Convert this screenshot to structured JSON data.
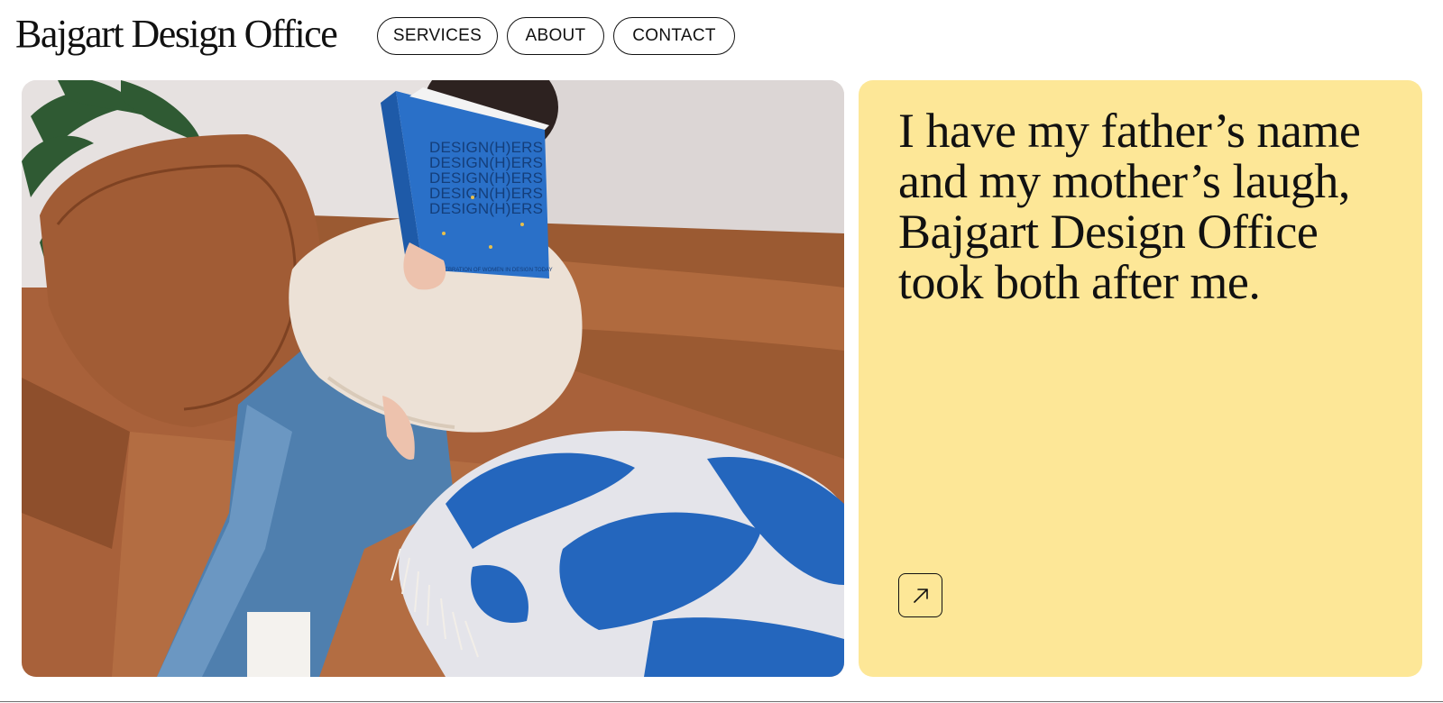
{
  "header": {
    "logo": "Bajgart Design Office",
    "nav": [
      {
        "label": "SERVICES"
      },
      {
        "label": "ABOUT"
      },
      {
        "label": "CONTACT"
      }
    ]
  },
  "hero_image": {
    "book_title_lines": [
      "DESIGN(H)ERS",
      "DESIGN(H)ERS",
      "DESIGN(H)ERS",
      "DESIGN(H)ERS",
      "DESIGN(H)ERS"
    ],
    "book_subtitle": "A CELEBRATION OF WOMEN IN DESIGN TODAY"
  },
  "quote_card": {
    "text": "I have my father’s name and my mother’s laugh, Bajgart Design Office took both after me.",
    "background": "#fde797",
    "arrow_icon": "arrow-up-right-icon"
  },
  "colors": {
    "page_bg": "#ffffff",
    "text": "#111111",
    "card_yellow": "#fde797",
    "sofa_brown": "#a55f35",
    "book_blue": "#2a70c8"
  }
}
